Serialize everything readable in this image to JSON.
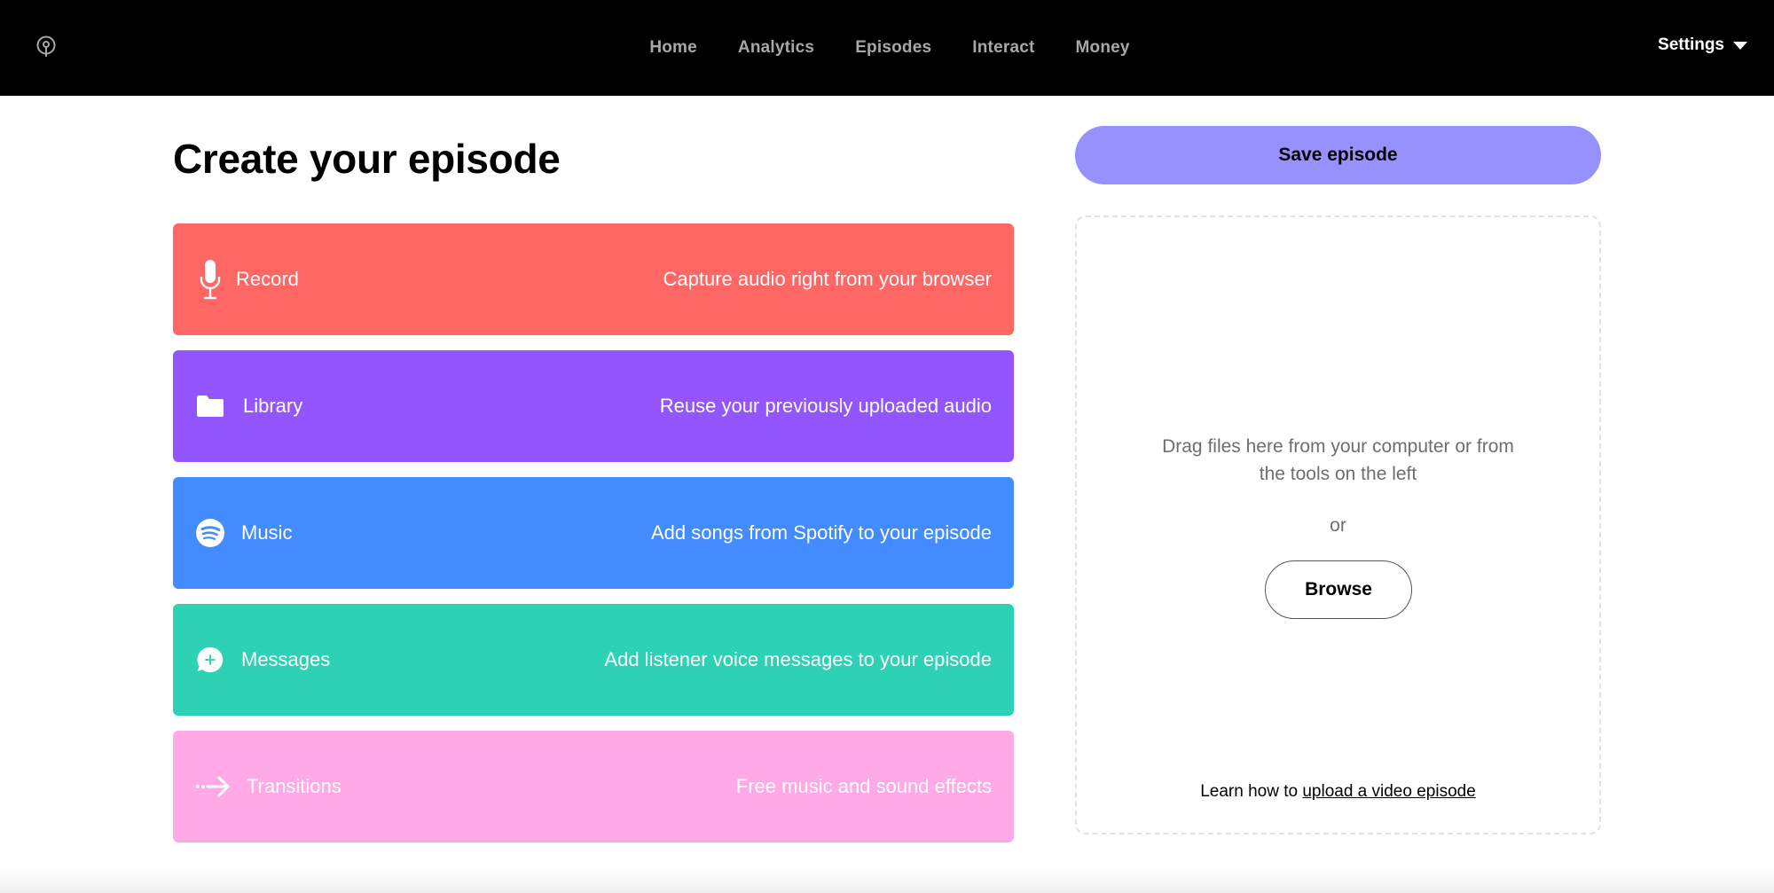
{
  "nav": {
    "items": [
      "Home",
      "Analytics",
      "Episodes",
      "Interact",
      "Money"
    ],
    "settings_label": "Settings"
  },
  "page": {
    "title": "Create your episode"
  },
  "tools": [
    {
      "label": "Record",
      "description": "Capture audio right from your browser",
      "color": "#ff6764",
      "icon": "microphone-icon"
    },
    {
      "label": "Library",
      "description": "Reuse your previously uploaded audio",
      "color": "#9355fd",
      "icon": "folder-icon"
    },
    {
      "label": "Music",
      "description": "Add songs from Spotify to your episode",
      "color": "#428cff",
      "icon": "spotify-icon"
    },
    {
      "label": "Messages",
      "description": "Add listener voice messages to your episode",
      "color": "#2dd1b3",
      "icon": "message-plus-icon"
    },
    {
      "label": "Transitions",
      "description": "Free music and sound effects",
      "color": "#ffaae6",
      "icon": "transition-arrow-icon"
    }
  ],
  "save_button": {
    "label": "Save episode",
    "color": "#9691ff"
  },
  "dropzone": {
    "text": "Drag files here from your computer or from the tools on the left",
    "or": "or",
    "browse_label": "Browse",
    "learn_prefix": "Learn how to ",
    "learn_link": "upload a video episode"
  }
}
